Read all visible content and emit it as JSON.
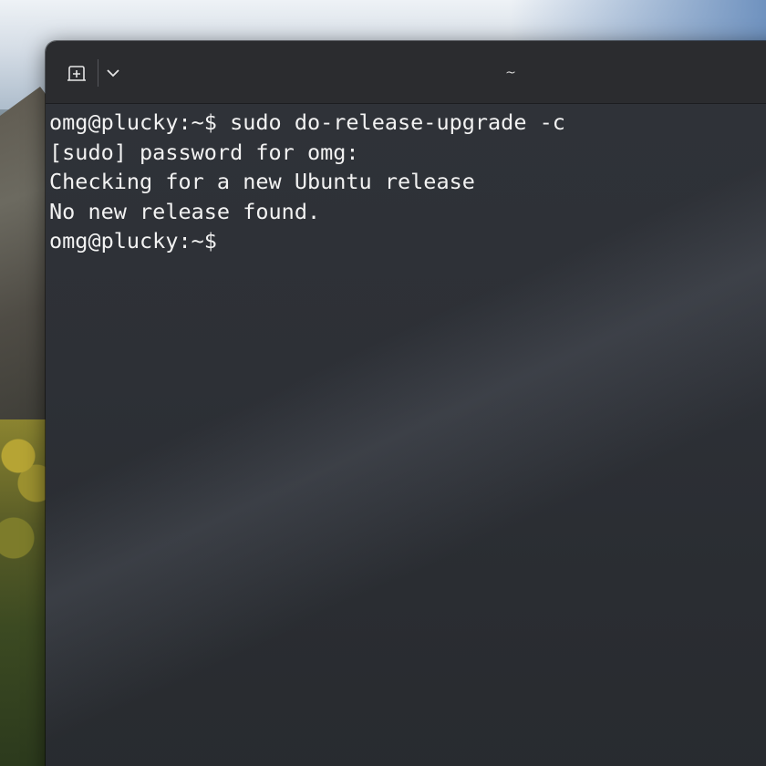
{
  "window": {
    "title": "~"
  },
  "toolbar": {
    "new_tab_icon": "new-tab-icon",
    "menu_icon": "chevron-down-icon"
  },
  "terminal": {
    "lines": [
      "omg@plucky:~$ sudo do-release-upgrade -c",
      "[sudo] password for omg:",
      "Checking for a new Ubuntu release",
      "No new release found.",
      "omg@plucky:~$"
    ]
  }
}
